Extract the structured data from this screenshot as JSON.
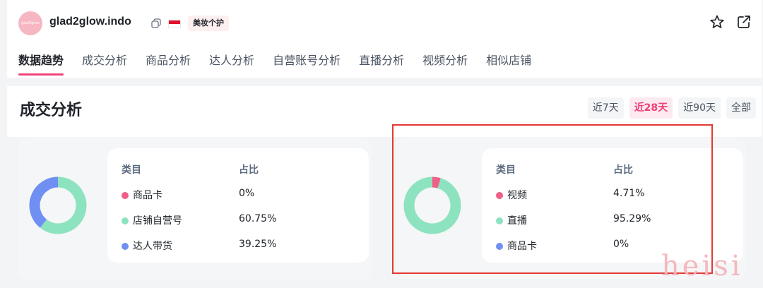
{
  "shop": {
    "avatar_text": "glad2glow",
    "name": "glad2glow.indo",
    "category_badge": "美妆个护"
  },
  "nav": {
    "tabs": [
      "数据趋势",
      "成交分析",
      "商品分析",
      "达人分析",
      "自营账号分析",
      "直播分析",
      "视频分析",
      "相似店铺"
    ]
  },
  "section": {
    "title": "成交分析",
    "ranges": [
      "近7天",
      "近28天",
      "近90天",
      "全部"
    ],
    "active_range": "近28天"
  },
  "panels": [
    {
      "header_category": "类目",
      "header_share": "占比",
      "rows": [
        {
          "label": "商品卡",
          "value": "0%",
          "share": 0,
          "color": "#ef5f86"
        },
        {
          "label": "店铺自营号",
          "value": "60.75%",
          "share": 60.75,
          "color": "#8de3bf"
        },
        {
          "label": "达人带货",
          "value": "39.25%",
          "share": 39.25,
          "color": "#6f8ff2"
        }
      ]
    },
    {
      "header_category": "类目",
      "header_share": "占比",
      "rows": [
        {
          "label": "视频",
          "value": "4.71%",
          "share": 4.71,
          "color": "#ef5f86"
        },
        {
          "label": "直播",
          "value": "95.29%",
          "share": 95.29,
          "color": "#8de3bf"
        },
        {
          "label": "商品卡",
          "value": "0%",
          "share": 0,
          "color": "#6f8ff2"
        }
      ]
    }
  ],
  "watermark": "heisi",
  "colors": {
    "accent": "#f0447a",
    "highlight_border": "#e53935"
  },
  "icons": {
    "copy": "copy-icon",
    "flag": "indonesia-flag-icon",
    "star": "star-icon",
    "share": "external-link-icon"
  }
}
